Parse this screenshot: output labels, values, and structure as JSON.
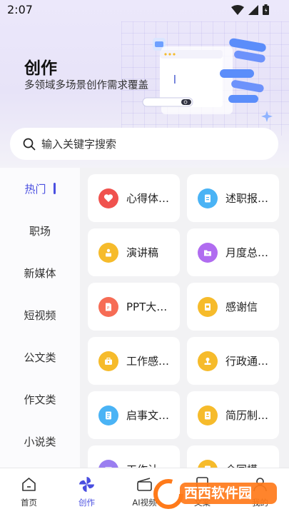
{
  "status_bar": {
    "time": "2:07",
    "icons": [
      "wifi-icon",
      "cellular-icon",
      "battery-icon"
    ]
  },
  "hero": {
    "title": "创作",
    "subtitle": "多领域多场景创作需求覆盖"
  },
  "search": {
    "placeholder": "输入关键字搜索"
  },
  "sidebar": {
    "items": [
      {
        "label": "热门",
        "active": true
      },
      {
        "label": "职场"
      },
      {
        "label": "新媒体"
      },
      {
        "label": "短视频"
      },
      {
        "label": "公文类"
      },
      {
        "label": "作文类"
      },
      {
        "label": "小说类"
      }
    ]
  },
  "cards": [
    {
      "label": "心得体…",
      "icon": "heart-icon",
      "color": "#f0524e"
    },
    {
      "label": "述职报…",
      "icon": "document-icon",
      "color": "#4ab3f5"
    },
    {
      "label": "演讲稿",
      "icon": "speaker-podium-icon",
      "color": "#f6bb2b"
    },
    {
      "label": "月度总…",
      "icon": "folder-icon",
      "color": "#b06cf0"
    },
    {
      "label": "PPT大…",
      "icon": "ppt-file-icon",
      "color": "#f66c55"
    },
    {
      "label": "感谢信",
      "icon": "letter-icon",
      "color": "#f6bb2b"
    },
    {
      "label": "工作感…",
      "icon": "briefcase-icon",
      "color": "#f6bb2b"
    },
    {
      "label": "行政通…",
      "icon": "stamp-icon",
      "color": "#f6bb2b"
    },
    {
      "label": "启事文…",
      "icon": "notice-icon",
      "color": "#4ab3f5"
    },
    {
      "label": "简历制…",
      "icon": "resume-icon",
      "color": "#f6bb2b"
    },
    {
      "label": "工作计…",
      "icon": "calendar-icon",
      "color": "#9a7ef0"
    },
    {
      "label": "合同模…",
      "icon": "contract-icon",
      "color": "#f6bb2b"
    }
  ],
  "tabs": [
    {
      "label": "首页",
      "icon": "home-icon"
    },
    {
      "label": "创作",
      "icon": "pinwheel-icon",
      "active": true
    },
    {
      "label": "AI视频",
      "icon": "clapperboard-icon"
    },
    {
      "label": "文案",
      "icon": "document-icon"
    },
    {
      "label": "我的",
      "icon": "user-icon"
    }
  ],
  "watermark": {
    "text": "西西软件园"
  },
  "colors": {
    "accent": "#4a4fe0",
    "hero_bg": "#ece8fb"
  }
}
